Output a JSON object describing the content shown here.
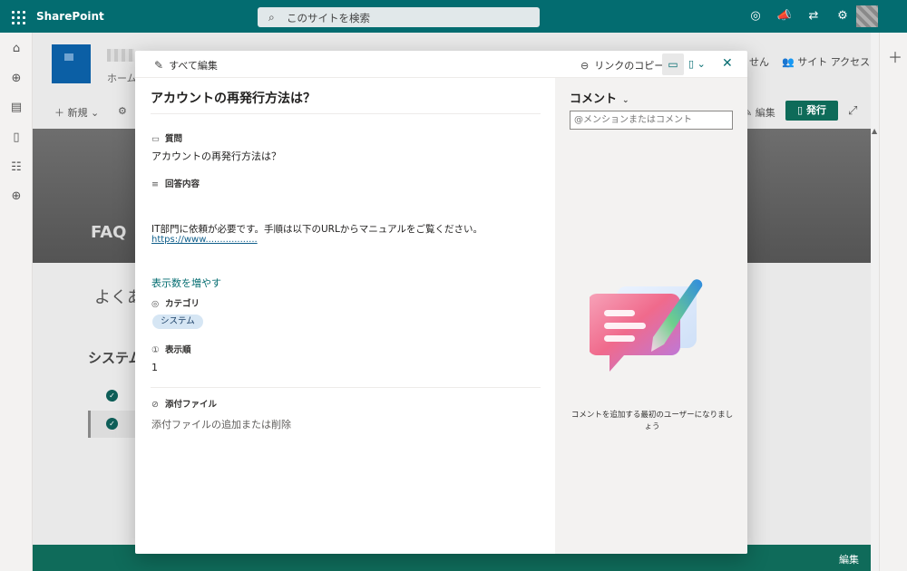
{
  "suite": {
    "brand": "SharePoint",
    "search_placeholder": "このサイトを検索"
  },
  "background": {
    "home_label": "ホーム",
    "right_text_1": "せん",
    "site_access": "サイト アクセス",
    "new_label": "新規",
    "edit_label": "編集",
    "publish_label": "発行",
    "hero_text": "FAQ",
    "section_title": "よくあ",
    "category_heading": "システム",
    "footer_edit": "編集"
  },
  "modal": {
    "edit_all": "すべて編集",
    "copy_link": "リンクのコピー",
    "title": "アカウントの再発行方法は？",
    "fields": {
      "question_label": "質問",
      "question_value": "アカウントの再発行方法は？",
      "answer_label": "回答内容",
      "answer_value": "IT部門に依頼が必要です。手順は以下のURLからマニュアルをご覧ください。",
      "answer_url": "https://www..................",
      "show_more": "表示数を増やす",
      "category_label": "カテゴリ",
      "category_value": "システム",
      "order_label": "表示順",
      "order_value": "1",
      "attachment_label": "添付ファイル",
      "attachment_add": "添付ファイルの追加または削除"
    },
    "comments": {
      "title": "コメント",
      "input_placeholder": "@メンションまたはコメント",
      "empty_message": "コメントを追加する最初のユーザーになりましょう"
    }
  },
  "colors": {
    "suite_bar": "#036c70",
    "accent": "#036c70",
    "publish": "#0e6b59"
  }
}
